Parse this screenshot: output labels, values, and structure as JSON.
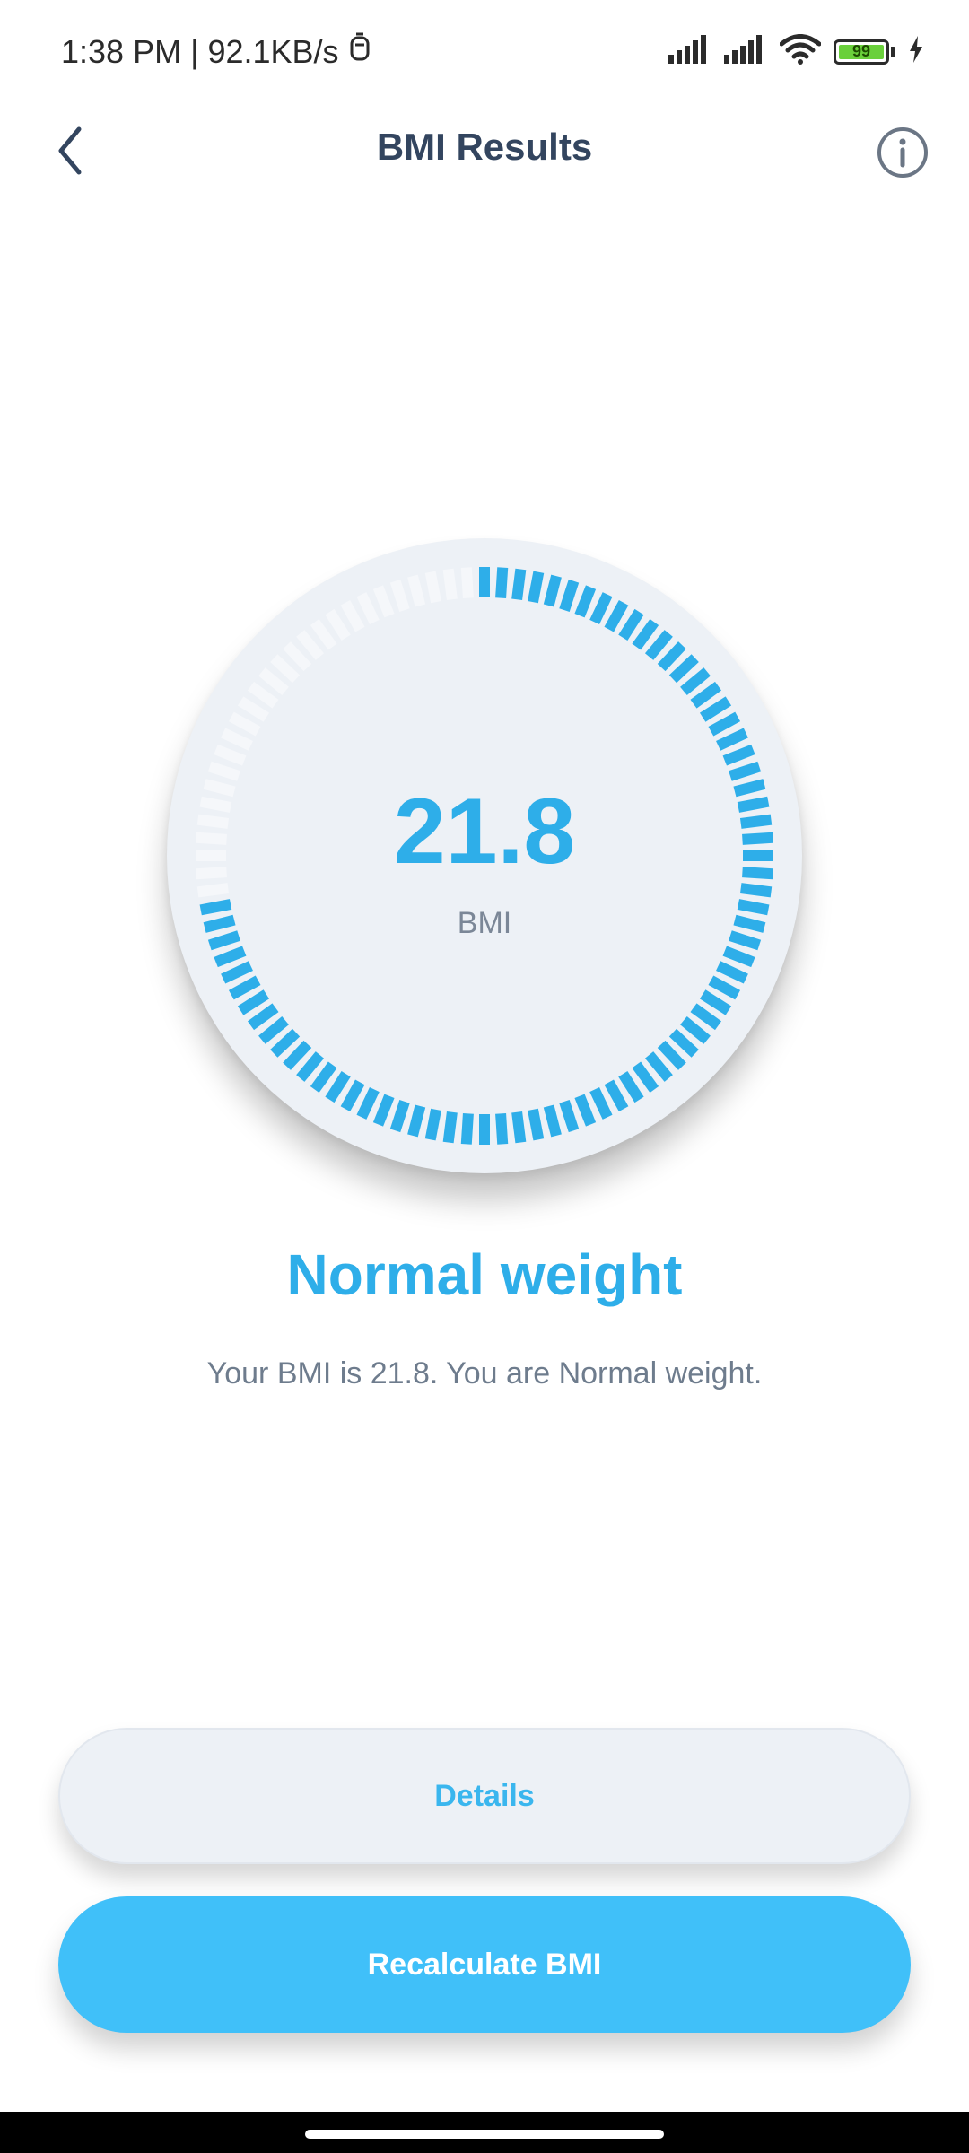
{
  "status_bar": {
    "time": "1:38 PM",
    "separator": "|",
    "network_speed": "92.1KB/s",
    "battery_level": "99",
    "icons": [
      "notification-icon",
      "signal-icon",
      "signal-icon",
      "wifi-icon",
      "battery-icon",
      "charging-icon"
    ]
  },
  "app_bar": {
    "title": "BMI Results",
    "back_icon": "chevron-left-icon",
    "info_icon": "info-icon"
  },
  "result": {
    "bmi_value": "21.8",
    "bmi_label": "BMI",
    "gauge_fill_fraction": 0.73,
    "category": "Normal weight",
    "message": "Your BMI is 21.8. You are Normal weight."
  },
  "actions": {
    "details_label": "Details",
    "recalculate_label": "Recalculate BMI"
  },
  "colors": {
    "accent": "#2eaee9",
    "primary_button": "#40c0f9",
    "gauge_track": "#f5f7fa",
    "title": "#33455f"
  }
}
